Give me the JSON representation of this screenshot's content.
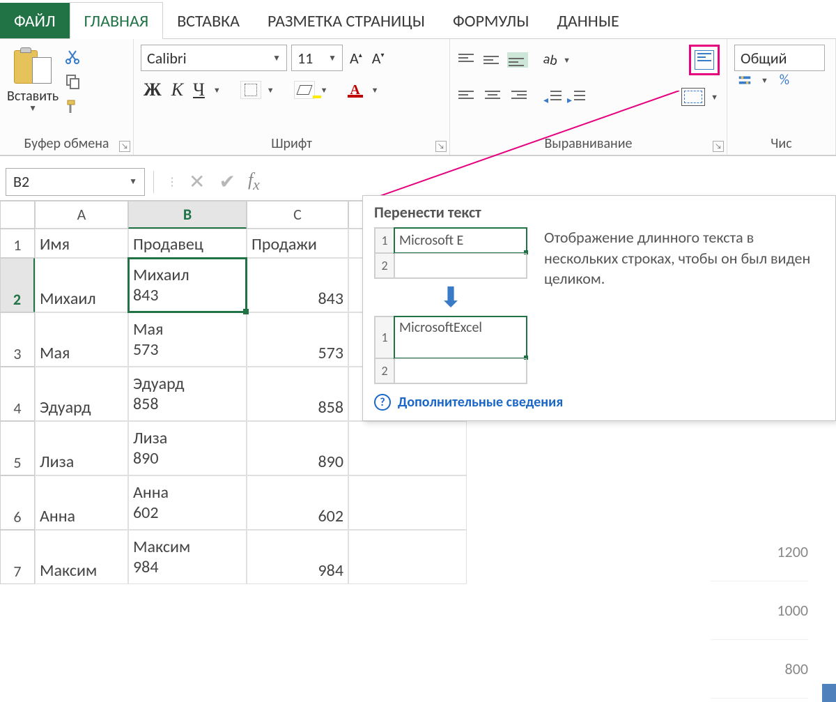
{
  "tabs": {
    "file": "ФАЙЛ",
    "home": "ГЛАВНАЯ",
    "insert": "ВСТАВКА",
    "layout": "РАЗМЕТКА СТРАНИЦЫ",
    "formulas": "ФОРМУЛЫ",
    "data": "ДАННЫЕ"
  },
  "ribbon": {
    "clipboard": {
      "paste": "Вставить",
      "label": "Буфер обмена"
    },
    "font": {
      "name": "Calibri",
      "size": "11",
      "bold": "Ж",
      "italic": "К",
      "underline": "Ч",
      "label": "Шрифт"
    },
    "alignment": {
      "label": "Выравнивание"
    },
    "number": {
      "format": "Общий",
      "percent": "%",
      "label": "Чис"
    }
  },
  "namebox": "B2",
  "sheet": {
    "columns": [
      "A",
      "B",
      "C"
    ],
    "headers": {
      "A": "Имя",
      "B": "Продавец",
      "C": "Продажи"
    },
    "selected_col": "B",
    "selected_row": "2",
    "rows": [
      {
        "n": "2",
        "A": "Михаил",
        "B": "Михаил\n843",
        "C": "843"
      },
      {
        "n": "3",
        "A": "Мая",
        "B": "Мая\n573",
        "C": "573"
      },
      {
        "n": "4",
        "A": "Эдуард",
        "B": "Эдуард\n858",
        "C": "858"
      },
      {
        "n": "5",
        "A": "Лиза",
        "B": "Лиза\n890",
        "C": "890"
      },
      {
        "n": "6",
        "A": "Анна",
        "B": "Анна\n602",
        "C": "602"
      },
      {
        "n": "7",
        "A": "Максим",
        "B": "Максим\n984",
        "C": "984"
      }
    ]
  },
  "tooltip": {
    "title": "Перенести текст",
    "demo_row1": "Microsoft E",
    "demo_row2_line1": "Microsoft",
    "demo_row2_line2": "Excel",
    "idx1": "1",
    "idx2": "2",
    "text": "Отображение длинного текста в нескольких строках, чтобы он был виден целиком.",
    "link": "Дополнительные сведения"
  },
  "chart_axis": {
    "v1": "1200",
    "v2": "1000",
    "v3": "800"
  }
}
